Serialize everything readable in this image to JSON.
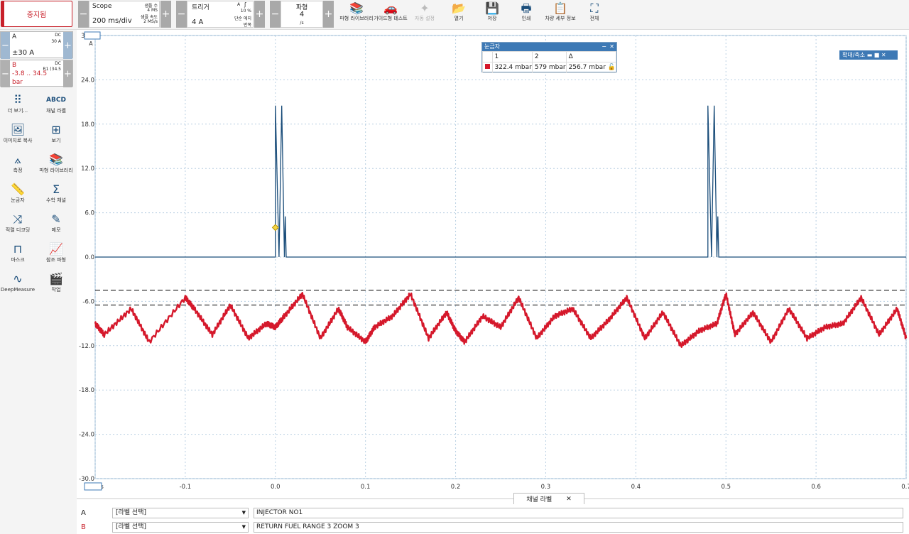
{
  "toolbar": {
    "stop_label": "중지됨",
    "scope": {
      "title": "Scope",
      "timebase": "200 ms/div",
      "samples_label": "샘플 수",
      "samples_value": "4 MS",
      "rate_label": "샘플 속도",
      "rate_value": "2 MS/s"
    },
    "trigger": {
      "title": "트리거",
      "level": "4 A",
      "channel": "A",
      "percent": "10 %",
      "mode1": "단순 에지",
      "mode2": "반복"
    },
    "waveforms": {
      "title": "파형",
      "count": "4",
      "unit": "/s"
    },
    "tools": [
      {
        "label": "파형 라이브러리",
        "icon": "library-icon",
        "glyph": "📚"
      },
      {
        "label": "가이드형 테스트",
        "icon": "car-icon",
        "glyph": "🚗"
      },
      {
        "label": "자동 설정",
        "icon": "wand-icon",
        "glyph": "✦"
      },
      {
        "label": "열기",
        "icon": "folder-open-icon",
        "glyph": "📂"
      },
      {
        "label": "저장",
        "icon": "save-icon",
        "glyph": "💾"
      },
      {
        "label": "인쇄",
        "icon": "print-icon",
        "glyph": "🖶"
      },
      {
        "label": "차량 세부 정보",
        "icon": "clipboard-icon",
        "glyph": "📋"
      },
      {
        "label": "전체",
        "icon": "fullscreen-icon",
        "glyph": "⛶"
      }
    ]
  },
  "channels": [
    {
      "name": "A",
      "coupling": "DC",
      "range_small": "30 A",
      "range": "±30 A"
    },
    {
      "name": "B",
      "coupling": "DC",
      "range_small": "R1 (34.5",
      "range": "-3.8 .. 34.5",
      "unit": "bar"
    }
  ],
  "sidebar": [
    {
      "label": "더 보기...",
      "icon": "dots-grid-icon",
      "glyph": "⠿"
    },
    {
      "label": "채널 라벨",
      "icon": "abcd-icon",
      "glyph": "ABCD"
    },
    {
      "label": "이미지로 복사",
      "icon": "image-icon",
      "glyph": "🖼"
    },
    {
      "label": "보기",
      "icon": "grid-view-icon",
      "glyph": "⊞"
    },
    {
      "label": "측정",
      "icon": "compass-icon",
      "glyph": "⟑"
    },
    {
      "label": "파형 라이브러리",
      "icon": "library-icon",
      "glyph": "📚"
    },
    {
      "label": "눈금자",
      "icon": "ruler-icon",
      "glyph": "📏"
    },
    {
      "label": "수학 채널",
      "icon": "sigma-icon",
      "glyph": "Σ"
    },
    {
      "label": "직렬 디코딩",
      "icon": "serial-decode-icon",
      "glyph": "⤨"
    },
    {
      "label": "메모",
      "icon": "memo-icon",
      "glyph": "✎"
    },
    {
      "label": "마스크",
      "icon": "mask-icon",
      "glyph": "⊓"
    },
    {
      "label": "참조 파형",
      "icon": "reference-waveform-icon",
      "glyph": "📈"
    },
    {
      "label": "DeepMeasure",
      "icon": "deepmeasure-icon",
      "glyph": "∿"
    },
    {
      "label": "작업",
      "icon": "clapper-icon",
      "glyph": "🎬"
    }
  ],
  "chart_data": {
    "type": "line",
    "y_unit": "A",
    "y_tick_labels": [
      "30.0",
      "24.0",
      "18.0",
      "12.0",
      "6.0",
      "0.0",
      "-6.0",
      "-12.0",
      "-18.0",
      "-24.0",
      "-30.0"
    ],
    "ylim": [
      -30,
      30
    ],
    "x_tick_labels": [
      "-0.2 s",
      "-0.1",
      "0.0",
      "0.1",
      "0.2",
      "0.3",
      "0.4",
      "0.5",
      "0.6",
      "0.7"
    ],
    "xlim": [
      -0.2,
      0.7
    ],
    "grid": true,
    "series": [
      {
        "name": "A",
        "color": "#1a4d7a",
        "description_points": [
          [
            -0.2,
            0
          ],
          [
            0.0,
            0
          ],
          [
            0.0,
            20.5
          ],
          [
            0.004,
            0
          ],
          [
            0.007,
            20.5
          ],
          [
            0.01,
            0
          ],
          [
            0.011,
            5.5
          ],
          [
            0.012,
            0
          ],
          [
            0.48,
            0
          ],
          [
            0.48,
            20.5
          ],
          [
            0.484,
            0
          ],
          [
            0.487,
            20.5
          ],
          [
            0.49,
            0
          ],
          [
            0.491,
            5.5
          ],
          [
            0.492,
            0
          ],
          [
            0.7,
            0
          ]
        ]
      },
      {
        "name": "B",
        "color": "#d5182b",
        "values_x": [
          -0.2,
          -0.19,
          -0.16,
          -0.14,
          -0.1,
          -0.09,
          -0.07,
          -0.05,
          -0.03,
          -0.01,
          0.0,
          0.01,
          0.03,
          0.05,
          0.07,
          0.08,
          0.1,
          0.11,
          0.13,
          0.15,
          0.17,
          0.19,
          0.2,
          0.21,
          0.23,
          0.25,
          0.27,
          0.29,
          0.31,
          0.33,
          0.35,
          0.37,
          0.39,
          0.41,
          0.43,
          0.45,
          0.47,
          0.49,
          0.5,
          0.51,
          0.53,
          0.55,
          0.57,
          0.59,
          0.61,
          0.63,
          0.65,
          0.67,
          0.69,
          0.7
        ],
        "values_y": [
          -9,
          -10.5,
          -7,
          -11.5,
          -5.5,
          -7,
          -10.5,
          -6.5,
          -11,
          -9,
          -9.5,
          -8,
          -5,
          -11,
          -7,
          -9.5,
          -11.5,
          -9.5,
          -8,
          -5,
          -11,
          -7.5,
          -10,
          -11.5,
          -8,
          -9.5,
          -5.5,
          -11,
          -8,
          -7,
          -11,
          -8.5,
          -5.5,
          -11,
          -7.5,
          -12,
          -10,
          -9,
          -5,
          -10.5,
          -7.5,
          -11.5,
          -7,
          -11,
          -9.5,
          -9,
          -5.5,
          -10.5,
          -7,
          -11
        ]
      },
      {
        "name": "ruler",
        "color": "#000",
        "dashed_levels": [
          -4.5,
          -6.5
        ]
      }
    ]
  },
  "cursor_table": {
    "title": "눈금자",
    "headers": [
      "1",
      "2",
      "Δ"
    ],
    "values": [
      "322.4 mbar",
      "579 mbar",
      "256.7 mbar"
    ],
    "color": "#d5182b"
  },
  "zoom_widget": "확대/축소",
  "bottom": {
    "tab_label": "채널 라벨",
    "rows": [
      {
        "channel": "A",
        "select": "[라벨 선택]",
        "text": "INJECTOR NO1"
      },
      {
        "channel": "B",
        "select": "[라벨 선택]",
        "text": "RETURN FUEL RANGE 3 ZOOM 3"
      }
    ]
  }
}
